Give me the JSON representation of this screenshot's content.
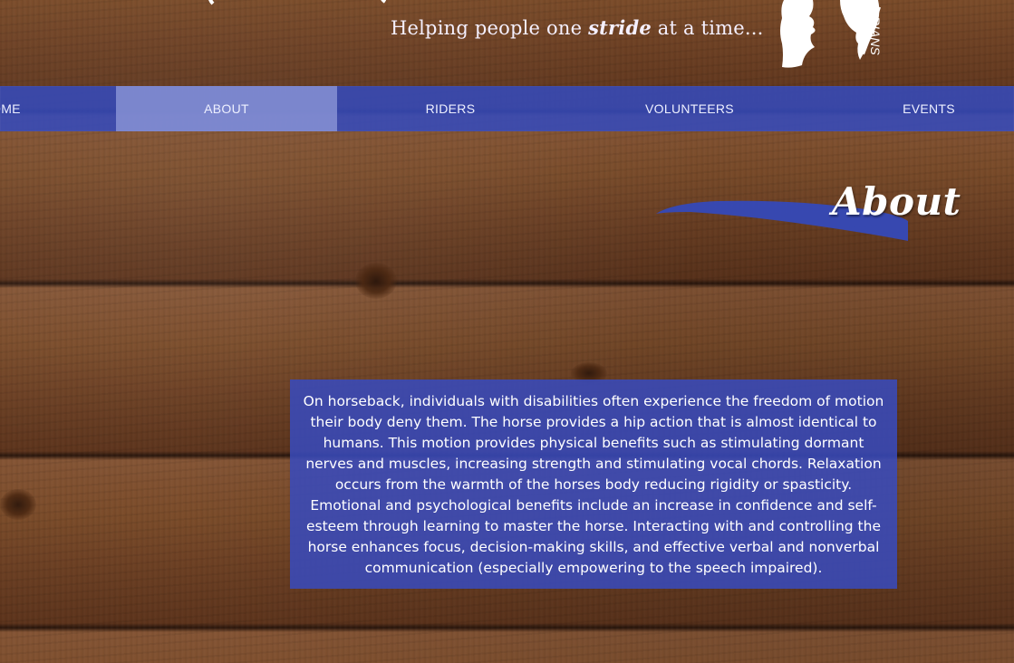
{
  "header": {
    "tagline_prefix": "Helping people one ",
    "tagline_emphasis": "stride",
    "tagline_suffix": " at a time...",
    "logo_text_fragment": "RIANS"
  },
  "nav": {
    "items": [
      {
        "label": "OME"
      },
      {
        "label": "ABOUT",
        "active": true
      },
      {
        "label": "RIDERS"
      },
      {
        "label": "VOLUNTEERS"
      },
      {
        "label": "EVENTS"
      }
    ]
  },
  "main": {
    "title": "About",
    "body": "On horseback, individuals with disabilities often experience the freedom of motion their body deny them. The horse provides a hip action that is almost identical to humans. This motion provides physical benefits such as stimulating dormant nerves and muscles, increasing strength and stimulating vocal chords. Relaxation occurs from the warmth of the horses body reducing rigidity or spasticity. Emotional and psychological benefits include an increase in confidence and self-esteem through learning to master the horse. Interacting with and controlling the horse enhances focus, decision-making skills, and effective verbal and nonverbal communication (especially empowering to the speech impaired)."
  },
  "colors": {
    "nav_blue": "#364ABA",
    "nav_active": "#8C96D7",
    "panel_blue": "#384ABE",
    "wood": "#6A3E22"
  },
  "icons": {
    "logo": "horse-and-rider-silhouette-logo"
  }
}
